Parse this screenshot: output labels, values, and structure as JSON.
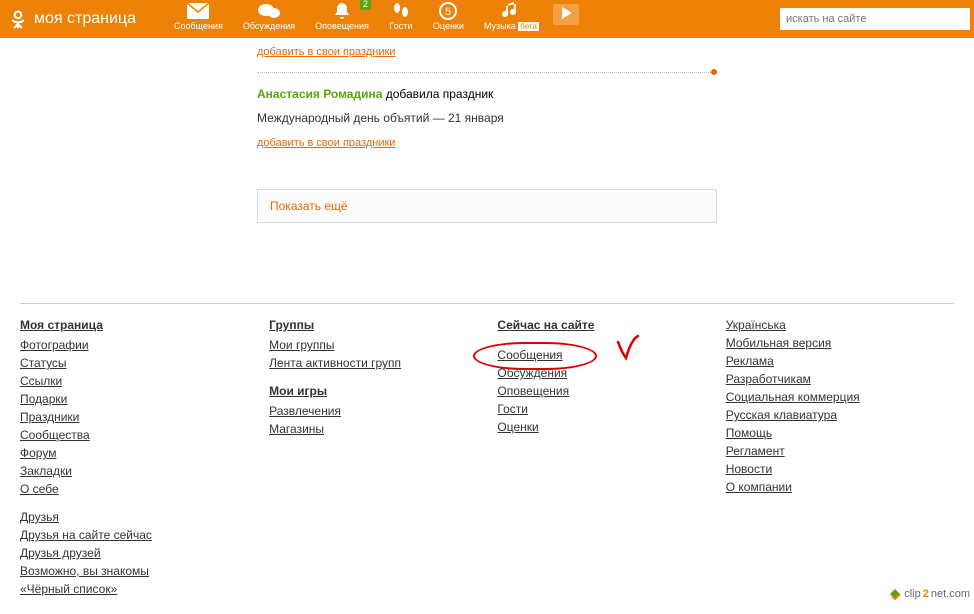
{
  "header": {
    "page_title": "моя страница",
    "nav": [
      {
        "label": "Сообщения"
      },
      {
        "label": "Обсуждения",
        "badge": ""
      },
      {
        "label": "Оповещения",
        "badge": "2"
      },
      {
        "label": "Гости"
      },
      {
        "label": "Оценки"
      },
      {
        "label": "Музыка",
        "beta": "бета"
      }
    ],
    "search_placeholder": "искать на сайте"
  },
  "feed": {
    "add_link_1": "добавить в свои праздники",
    "user_name": "Анастасия Ромадина",
    "user_action": " добавила праздник",
    "event_desc": "Международный день объятий — 21 января",
    "add_link_2": "добавить в свои праздники",
    "show_more": "Показать ещё"
  },
  "footer": {
    "col1": {
      "title": "Моя страница",
      "links": [
        "Фотографии",
        "Статусы",
        "Ссылки",
        "Подарки",
        "Праздники",
        "Сообщества",
        "Форум",
        "Закладки",
        "О себе"
      ],
      "links2": [
        "Друзья",
        "Друзья на сайте сейчас",
        "Друзья друзей",
        "Возможно, вы знакомы",
        "«Чёрный список»"
      ]
    },
    "col2": {
      "title1": "Группы",
      "links1": [
        "Мои группы",
        "Лента активности групп"
      ],
      "title2": "Мои игры",
      "links2": [
        "Развлечения",
        "Магазины"
      ]
    },
    "col3": {
      "title": "Сейчас на сайте",
      "links": [
        "Сообщения",
        "Обсуждения",
        "Оповещения",
        "Гости",
        "Оценки"
      ]
    },
    "col4": {
      "links": [
        "Українська",
        "Мобильная версия",
        "Реклама",
        "Разработчикам",
        "Социальная коммерция",
        "Русская клавиатура",
        "Помощь",
        "Регламент",
        "Новости",
        "О компании"
      ]
    }
  },
  "watermark": {
    "pre": "clip",
    "mid": "2",
    "post": "net.com"
  }
}
